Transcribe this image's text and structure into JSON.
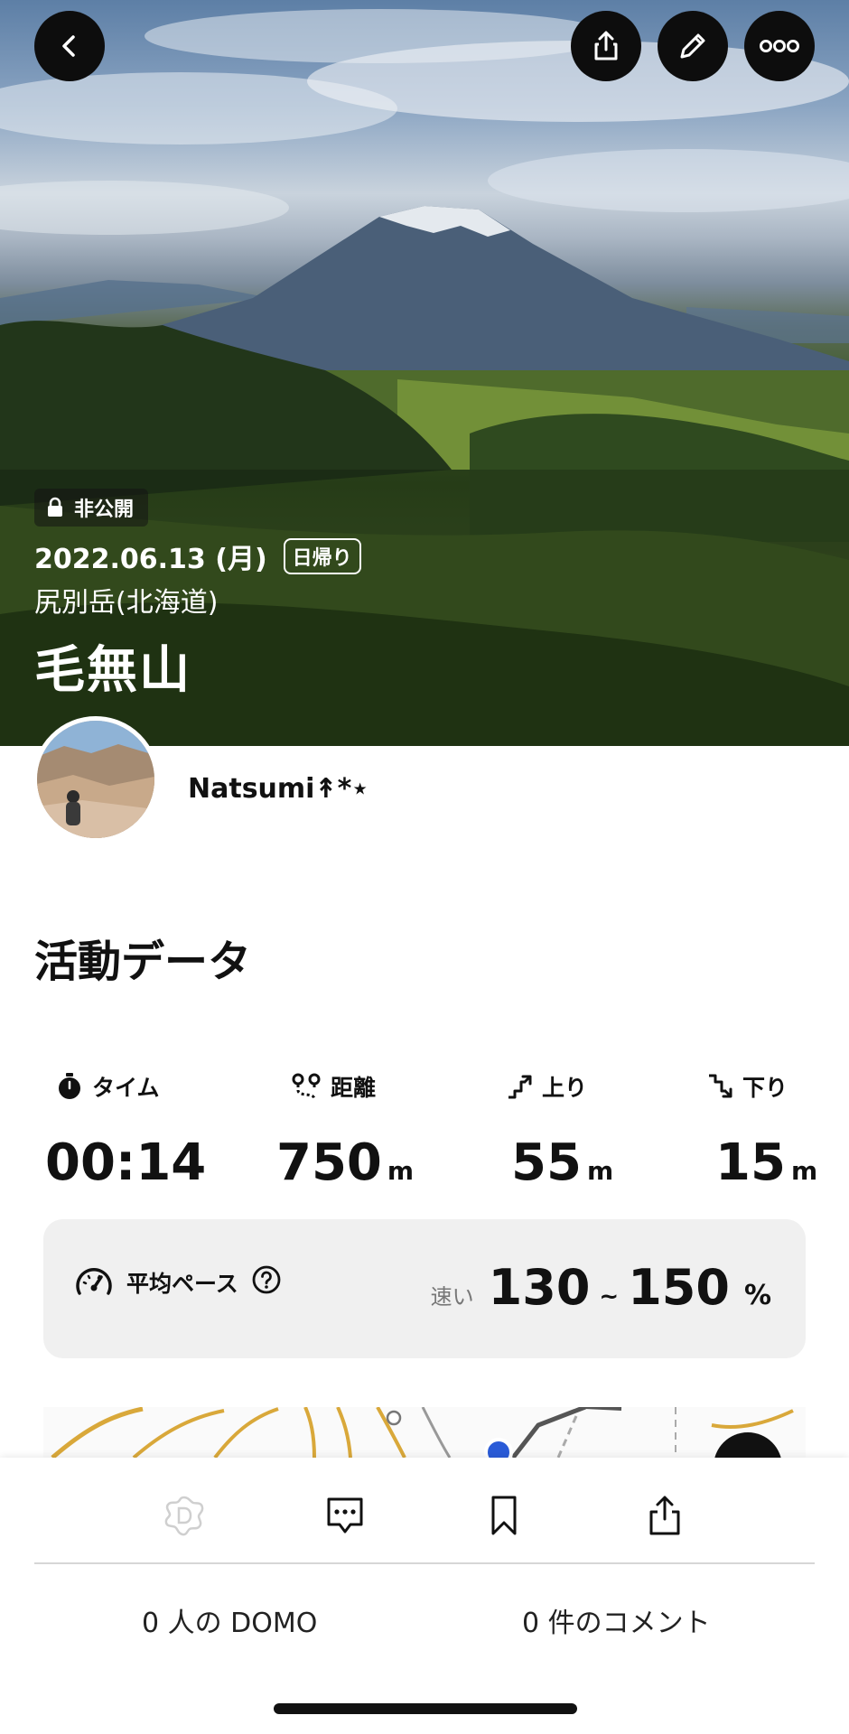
{
  "header": {
    "back_icon": "chevron-left-icon",
    "share_icon": "share-icon",
    "edit_icon": "pencil-icon",
    "more_icon": "more-horizontal-icon"
  },
  "hero": {
    "privacy_label": "非公開",
    "date": "2022.06.13 (月)",
    "trip_type": "日帰り",
    "area": "尻別岳(北海道)",
    "mountain_name": "毛無山"
  },
  "user": {
    "name": "Natsumi↟*⋆"
  },
  "activity": {
    "title": "活動データ",
    "stats": [
      {
        "label": "タイム",
        "value": "00:14",
        "unit": "",
        "icon": "stopwatch-icon"
      },
      {
        "label": "距離",
        "value": "750",
        "unit": "m",
        "icon": "route-distance-icon"
      },
      {
        "label": "上り",
        "value": "55",
        "unit": "m",
        "icon": "ascent-icon"
      },
      {
        "label": "下り",
        "value": "15",
        "unit": "m",
        "icon": "descent-icon"
      }
    ],
    "pace": {
      "label": "平均ペース",
      "speed_word": "速い",
      "min": "130",
      "separator": "~",
      "max": "150",
      "unit": "%"
    }
  },
  "bottom_bar": {
    "domo_count_label": "0 人の DOMO",
    "comment_count_label": "0 件のコメント"
  },
  "colors": {
    "dark_button": "#0d0d0d",
    "card_bg": "#f0f0f0",
    "map_contour": "#d9a83a"
  }
}
